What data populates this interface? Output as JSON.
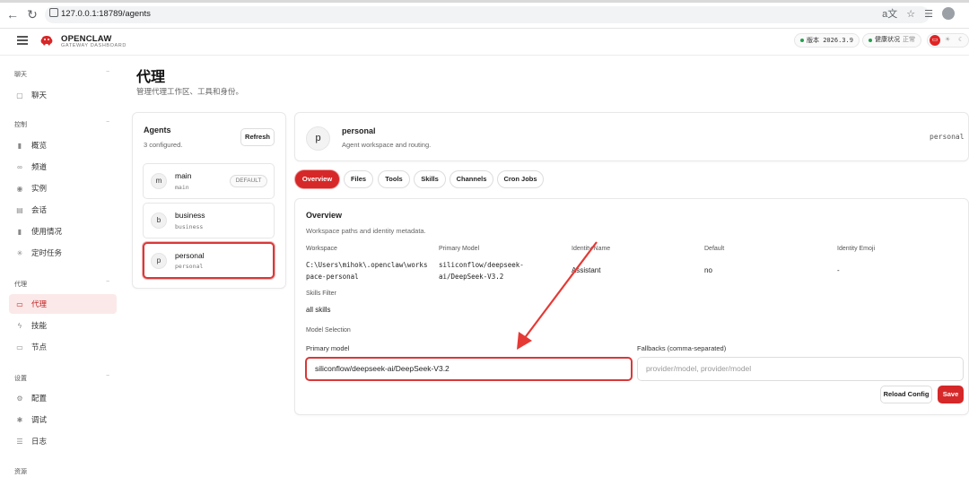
{
  "browser": {
    "url": "127.0.0.1:18789/agents"
  },
  "header": {
    "brand": "OPENCLAW",
    "brand_sub": "GATEWAY DASHBOARD",
    "version_label": "版本 2026.3.9",
    "health_label": "健康状况",
    "health_value": "正常"
  },
  "sidebar": {
    "sections": [
      {
        "label": "聊天"
      },
      {
        "label": "控制"
      },
      {
        "label": "代理"
      },
      {
        "label": "设置"
      },
      {
        "label": "资源"
      }
    ],
    "items": [
      {
        "label": "聊天",
        "icon": "chat-icon"
      },
      {
        "label": "概览",
        "icon": "bar-chart-icon"
      },
      {
        "label": "频道",
        "icon": "link-icon"
      },
      {
        "label": "实例",
        "icon": "radio-icon"
      },
      {
        "label": "会话",
        "icon": "document-icon"
      },
      {
        "label": "使用情况",
        "icon": "bar-chart-icon"
      },
      {
        "label": "定时任务",
        "icon": "sparkle-icon"
      },
      {
        "label": "代理",
        "icon": "folder-icon"
      },
      {
        "label": "技能",
        "icon": "lightning-icon"
      },
      {
        "label": "节点",
        "icon": "monitor-icon"
      },
      {
        "label": "配置",
        "icon": "gear-icon"
      },
      {
        "label": "调试",
        "icon": "bug-icon"
      },
      {
        "label": "日志",
        "icon": "log-icon"
      }
    ]
  },
  "page": {
    "title": "代理",
    "subtitle": "管理代理工作区、工具和身份。"
  },
  "agents_panel": {
    "title": "Agents",
    "count": "3 configured.",
    "refresh_label": "Refresh",
    "default_badge": "DEFAULT",
    "agents": [
      {
        "initial": "m",
        "name": "main",
        "id": "main"
      },
      {
        "initial": "b",
        "name": "business",
        "id": "business"
      },
      {
        "initial": "p",
        "name": "personal",
        "id": "personal"
      }
    ]
  },
  "agent_header": {
    "initial": "p",
    "name": "personal",
    "description": "Agent workspace and routing.",
    "id": "personal"
  },
  "tabs": [
    "Overview",
    "Files",
    "Tools",
    "Skills",
    "Channels",
    "Cron Jobs"
  ],
  "overview": {
    "title": "Overview",
    "description": "Workspace paths and identity metadata.",
    "fields": {
      "workspace_label": "Workspace",
      "workspace_line1": "C:\\Users\\mihok\\.openclaw\\works",
      "workspace_line2": "pace-personal",
      "primary_model_label": "Primary Model",
      "primary_model_line1": "siliconflow/deepseek-",
      "primary_model_line2": "ai/DeepSeek-V3.2",
      "identity_name_label": "Identity Name",
      "identity_name": "Assistant",
      "default_label": "Default",
      "default_value": "no",
      "identity_emoji_label": "Identity Emoji",
      "identity_emoji": "-",
      "skills_filter_label": "Skills Filter",
      "skills_filter": "all skills"
    },
    "model_selection_label": "Model Selection",
    "primary_model_input_label": "Primary model",
    "primary_model_input_value": "siliconflow/deepseek-ai/DeepSeek-V3.2",
    "fallbacks_label": "Fallbacks (comma-separated)",
    "fallbacks_placeholder": "provider/model, provider/model",
    "reload_label": "Reload Config",
    "save_label": "Save"
  },
  "colors": {
    "accent": "#d62828",
    "active_bg": "#fbe9e9",
    "status_ok": "#22a04b"
  }
}
